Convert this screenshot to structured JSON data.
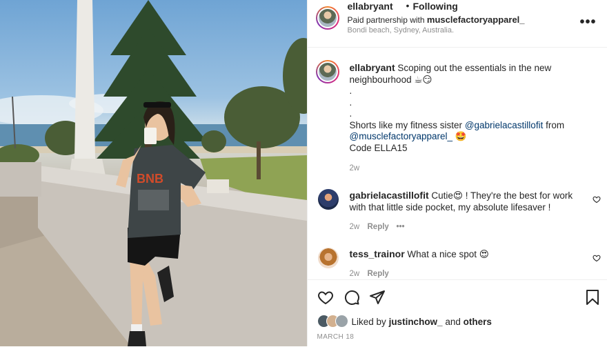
{
  "header": {
    "username": "ellabryant",
    "separator": "•",
    "follow_status": "Following",
    "partnership_prefix": "Paid partnership with",
    "partner_name": "musclefactoryapparel_",
    "location": "Bondi beach, Sydney, Australia.",
    "more_label": "•••"
  },
  "caption": {
    "username": "ellabryant",
    "text_1": "Scoping out the essentials in the new neighbourhood ☕😏",
    "dot_1": ".",
    "dot_2": ".",
    "dot_3": ".",
    "text_2": "Shorts like my fitness sister",
    "mention_1": "@gabrielacastillofit",
    "text_3": "from",
    "mention_2": "@musclefactoryapparel_",
    "emoji_1": "🤩",
    "text_4": "Code ELLA15",
    "time": "2w"
  },
  "comments": [
    {
      "username": "gabrielacastillofit",
      "text": "Cutie😍 ! They're the best for work with that little side pocket, my absolute lifesaver !",
      "time": "2w",
      "reply": "Reply",
      "more": "•••"
    },
    {
      "username": "tess_trainor",
      "text": "What a nice spot 😍",
      "time": "2w",
      "reply": "Reply"
    }
  ],
  "footer": {
    "liked_prefix": "Liked by",
    "liked_user": "justinchow_",
    "liked_and": "and",
    "liked_others": "others",
    "date": "MARCH 18"
  },
  "icons": {
    "like": "heart-icon",
    "comment": "comment-icon",
    "share": "paper-plane-icon",
    "save": "bookmark-icon"
  },
  "colors": {
    "mention": "#00376b",
    "muted": "#8e8e8e",
    "text": "#262626"
  }
}
